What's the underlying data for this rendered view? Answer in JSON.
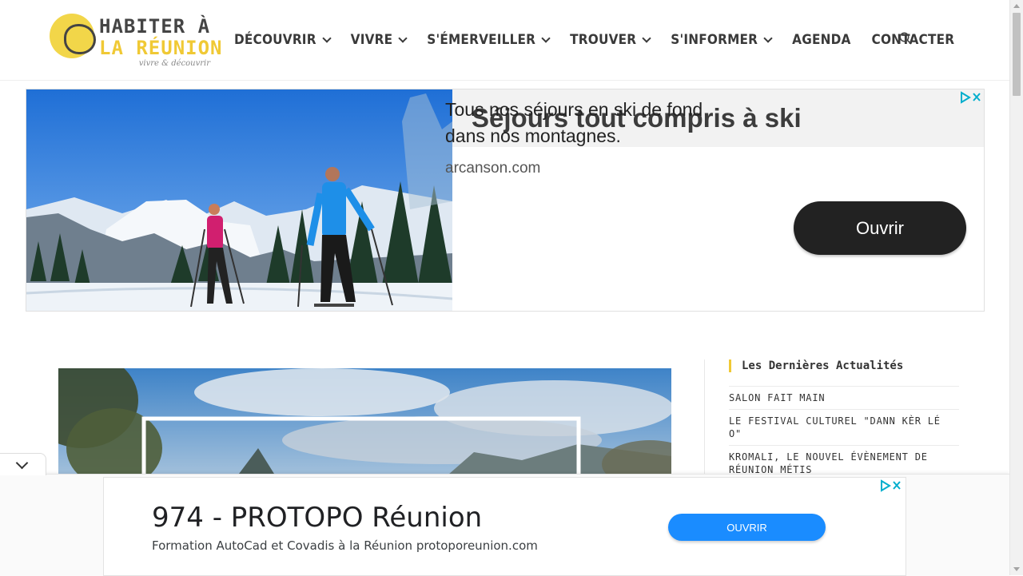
{
  "logo": {
    "line1": "HABITER À",
    "line2_start": "LA RÉUNION",
    "tagline": "vivre & découvrir"
  },
  "nav": {
    "items": [
      {
        "label": "DÉCOUVRIR",
        "dropdown": true
      },
      {
        "label": "VIVRE",
        "dropdown": true
      },
      {
        "label": "S'ÉMERVEILLER",
        "dropdown": true
      },
      {
        "label": "TROUVER",
        "dropdown": true
      },
      {
        "label": "S'INFORMER",
        "dropdown": true
      },
      {
        "label": "AGENDA",
        "dropdown": false
      },
      {
        "label": "CONTACTER",
        "dropdown": false
      }
    ],
    "search_icon": "search-icon"
  },
  "ad_top": {
    "title": "Séjours tout compris à ski",
    "description": "Tous nos séjours en ski de fond dans nos montagnes.",
    "domain": "arcanson.com",
    "button": "Ouvrir",
    "adchoices_icon": "adchoices-icon",
    "close_icon": "close-icon"
  },
  "sidebar": {
    "widget_title": "Les Dernières Actualités",
    "posts": [
      "SALON FAIT MAIN",
      "LE FESTIVAL CULTUREL \"DANN KÈR LÉ O\"",
      "KROMALI, LE NOUVEL ÉVÈNEMENT DE RÉUNION MÉTIS"
    ]
  },
  "ad_bottom": {
    "title": "974 - PROTOPO Réunion",
    "description": "Formation AutoCad et Covadis à la Réunion protoporeunion.com",
    "button": "OUVRIR"
  },
  "colors": {
    "brand_yellow": "#f0c935",
    "nav_text": "#3a3a3a",
    "ad_button_dark": "#222222",
    "ad_button_blue": "#1a8cff",
    "adchoices_teal": "#00aecd"
  }
}
